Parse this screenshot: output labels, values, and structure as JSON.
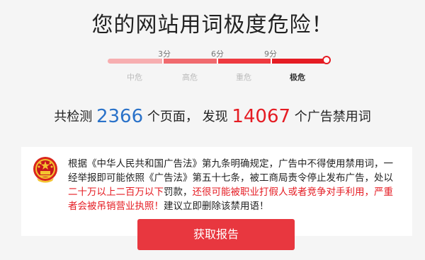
{
  "title": "您的网站用词极度危险！",
  "meter": {
    "ticks": [
      "3分",
      "6分",
      "9分"
    ],
    "levels": [
      "中危",
      "高危",
      "重危",
      "极危"
    ],
    "active_level": "极危",
    "level_fraction": 1.0,
    "colors": [
      "#f7aeb0",
      "#f06a6e",
      "#ee3a40",
      "#e51c23"
    ]
  },
  "stats": {
    "prefix": "共检测",
    "pages": "2366",
    "pages_unit": "个页面，",
    "found_label": "发现",
    "words": "14067",
    "words_unit": "个广告禁用词"
  },
  "notice": {
    "emblem_icon": "national-emblem-icon",
    "text_normal_1": "根据《中华人民共和国广告法》第九条明确规定，广告中不得使用禁用词，一经举报即可能依照《广告法》第五十七条，被工商局责令停止发布广告，处以",
    "text_red_1": "二十万以上二百万以下",
    "text_normal_2": "罚款，",
    "text_red_2": "还很可能被职业打假人或者竞争对手利用，严重者会被吊销营业执照！",
    "text_normal_3": "建议立即删除该禁用语！"
  },
  "button": {
    "label": "获取报告"
  }
}
